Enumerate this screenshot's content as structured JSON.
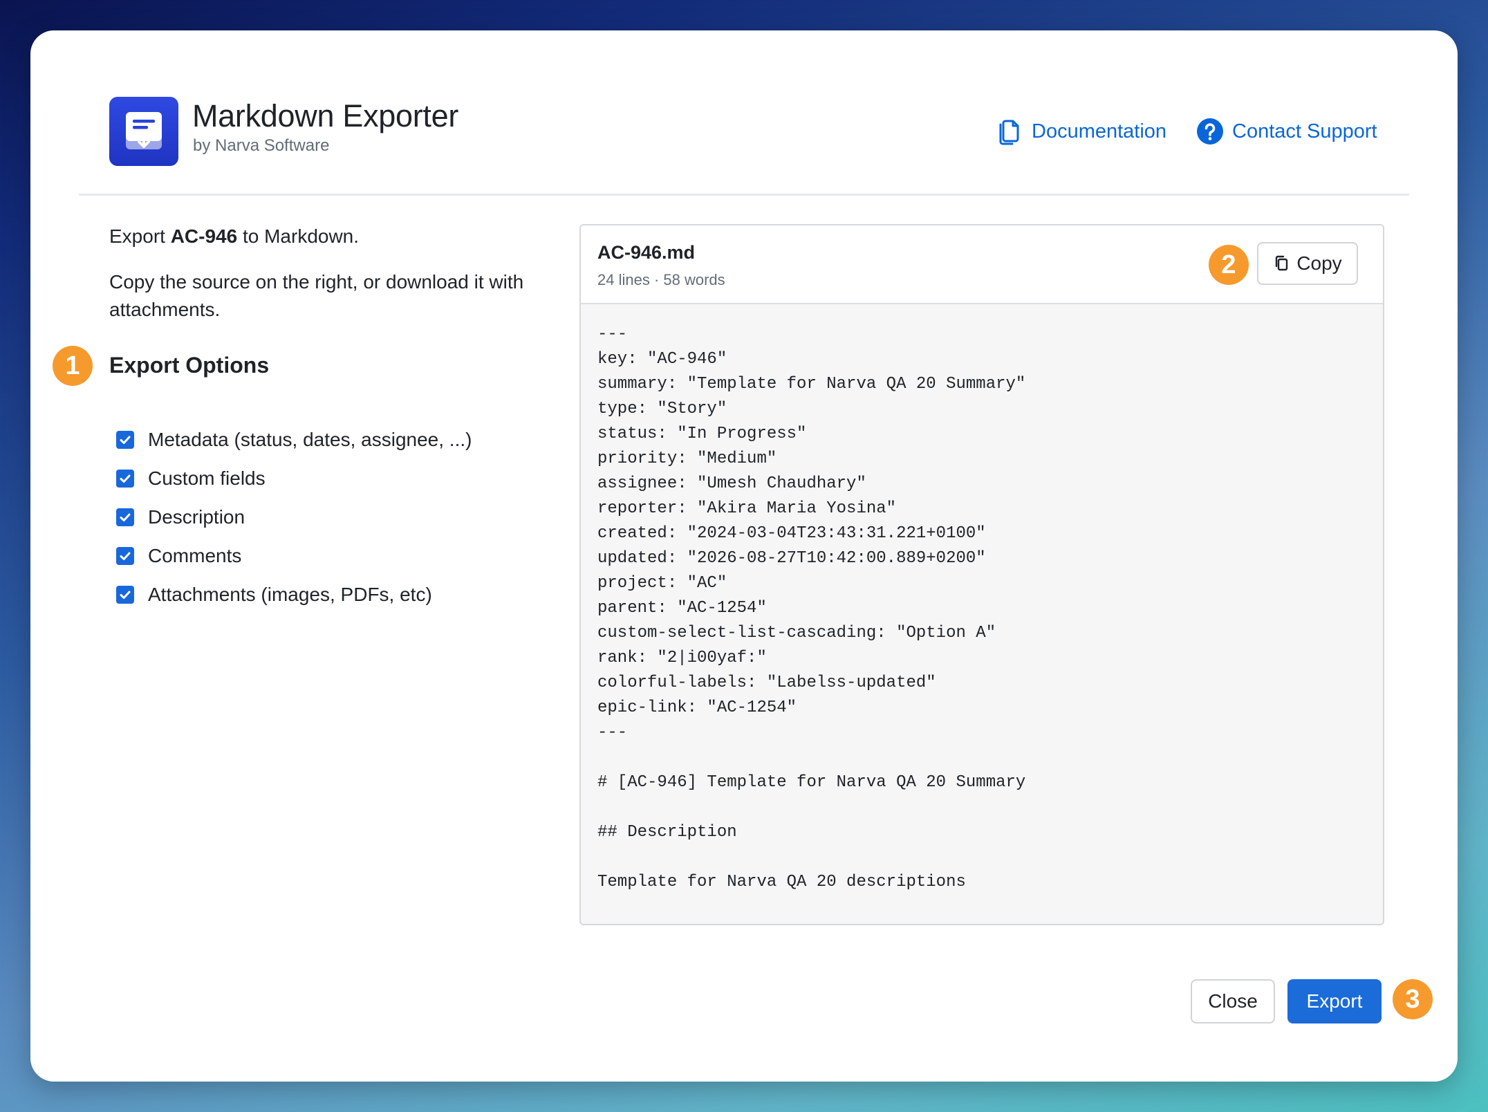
{
  "app": {
    "name": "Markdown Exporter",
    "vendor": "by Narva Software",
    "logo_icon": "document-download-icon",
    "brand_color": "#2a42d8"
  },
  "header_links": {
    "documentation": "Documentation",
    "documentation_icon": "documents-icon",
    "contact_support": "Contact Support",
    "contact_support_icon": "question-circle-icon",
    "link_color": "#0a66d8"
  },
  "intro": {
    "prefix": "Export ",
    "issue_key": "AC-946",
    "suffix": " to Markdown.",
    "instructions": "Copy the source on the right, or download it with attachments."
  },
  "steps": {
    "one": "1",
    "two": "2",
    "three": "3",
    "badge_color": "#f79a2d"
  },
  "options": {
    "heading": "Export Options",
    "items": [
      {
        "label": "Metadata (status, dates, assignee, ...)",
        "checked": true
      },
      {
        "label": "Custom fields",
        "checked": true
      },
      {
        "label": "Description",
        "checked": true
      },
      {
        "label": "Comments",
        "checked": true
      },
      {
        "label": "Attachments (images, PDFs, etc)",
        "checked": true
      }
    ]
  },
  "file": {
    "name": "AC-946.md",
    "stats": "24 lines · 58 words",
    "copy_label": "Copy",
    "copy_icon": "copy-icon",
    "content": "---\nkey: \"AC-946\"\nsummary: \"Template for Narva QA 20 Summary\"\ntype: \"Story\"\nstatus: \"In Progress\"\npriority: \"Medium\"\nassignee: \"Umesh Chaudhary\"\nreporter: \"Akira Maria Yosina\"\ncreated: \"2024-03-04T23:43:31.221+0100\"\nupdated: \"2026-08-27T10:42:00.889+0200\"\nproject: \"AC\"\nparent: \"AC-1254\"\ncustom-select-list-cascading: \"Option A\"\nrank: \"2|i00yaf:\"\ncolorful-labels: \"Labelss-updated\"\nepic-link: \"AC-1254\"\n---\n\n# [AC-946] Template for Narva QA 20 Summary\n\n## Description\n\nTemplate for Narva QA 20 descriptions"
  },
  "footer": {
    "close_label": "Close",
    "export_label": "Export",
    "primary_color": "#1b6bd9"
  }
}
